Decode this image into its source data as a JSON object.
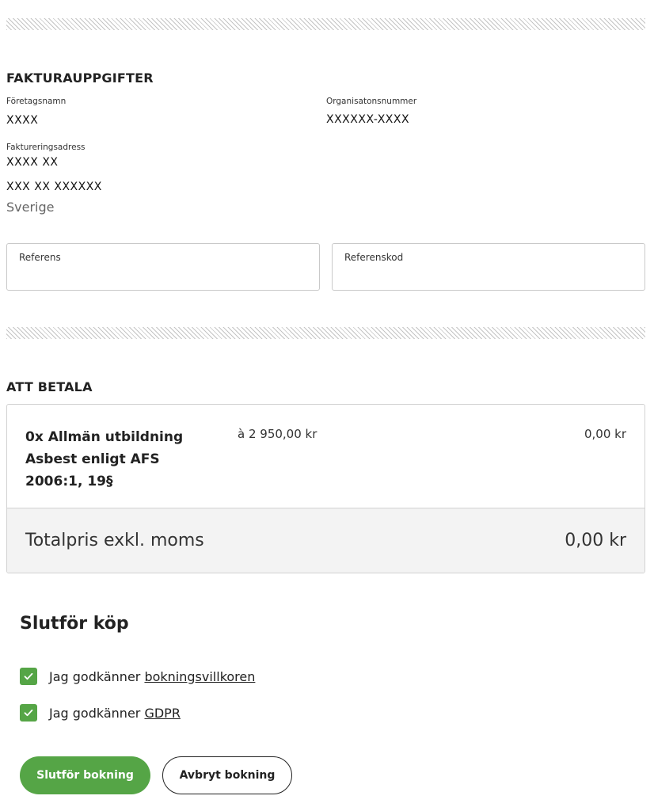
{
  "invoice": {
    "heading": "FAKTURAUPPGIFTER",
    "company_label": "Företagsnamn",
    "company_value": "XXXX",
    "org_label": "Organisatonsnummer",
    "org_value": "XXXXXX-XXXX",
    "address_label": "Faktureringsadress",
    "address_line1": "XXXX XX",
    "address_line2": "XXX XX XXXXXX",
    "country": "Sverige"
  },
  "reference_fields": {
    "reference_label": "Referens",
    "reference_value": "",
    "reference_code_label": "Referenskod",
    "reference_code_value": ""
  },
  "payment": {
    "heading": "ATT BETALA",
    "item": {
      "name": "0x Allmän utbildning Asbest enligt AFS 2006:1, 19§",
      "unit_price": "à 2 950,00 kr",
      "sum": "0,00 kr"
    },
    "total_label": "Totalpris exkl. moms",
    "total_value": "0,00 kr"
  },
  "finish": {
    "heading": "Slutför köp",
    "terms": {
      "checked": true,
      "prefix": "Jag godkänner ",
      "link": "bokningsvillkoren"
    },
    "gdpr": {
      "checked": true,
      "prefix": "Jag godkänner ",
      "link": "GDPR"
    },
    "primary_button": "Slutför bokning",
    "secondary_button": "Avbryt bokning"
  },
  "colors": {
    "accent_green": "#55a546",
    "total_row_bg": "#f3f3f3"
  },
  "icons": {
    "checkbox": "check-icon"
  }
}
